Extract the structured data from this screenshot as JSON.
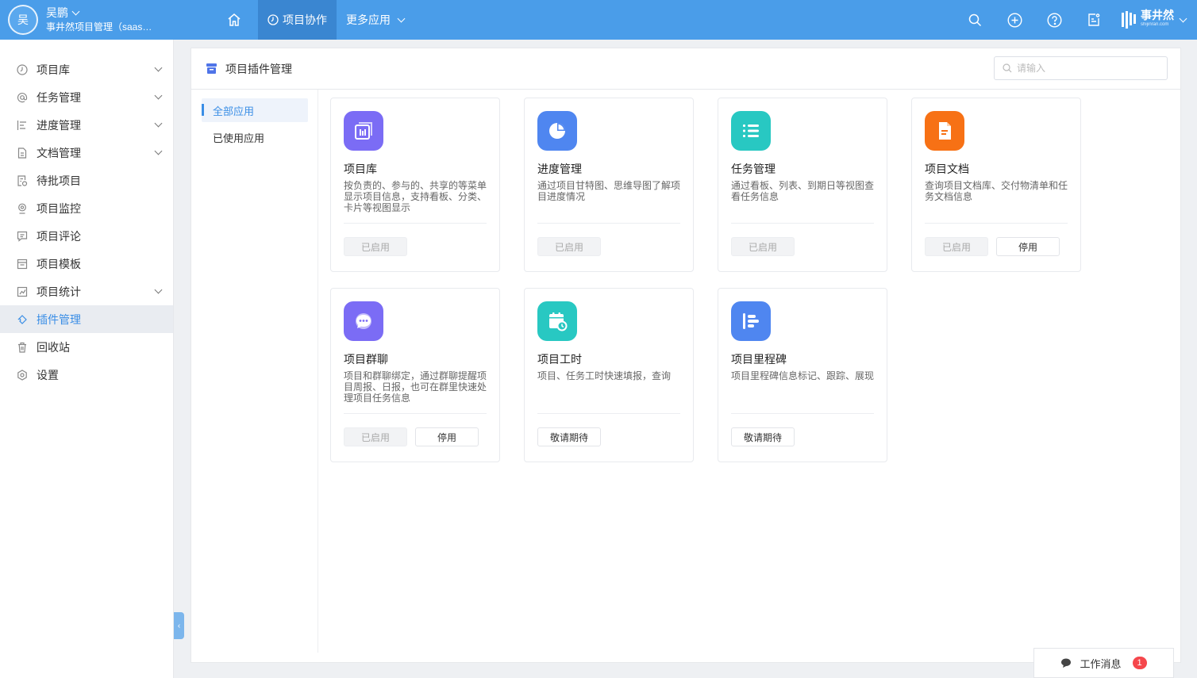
{
  "user": {
    "avatar_char": "吴",
    "name": "吴鹏",
    "org": "事井然项目管理（saas版）"
  },
  "topnav": [
    {
      "label": "项目协作",
      "active": true
    },
    {
      "label": "更多应用",
      "active": false
    }
  ],
  "brand": {
    "name": "事井然",
    "sub": "shijinran.com"
  },
  "sidebar": [
    {
      "label": "项目库",
      "icon": "clock-icon",
      "expandable": true
    },
    {
      "label": "任务管理",
      "icon": "at-icon",
      "expandable": true
    },
    {
      "label": "进度管理",
      "icon": "progress-icon",
      "expandable": true
    },
    {
      "label": "文档管理",
      "icon": "document-icon",
      "expandable": true
    },
    {
      "label": "待批项目",
      "icon": "approval-icon",
      "expandable": false
    },
    {
      "label": "项目监控",
      "icon": "monitor-icon",
      "expandable": false
    },
    {
      "label": "项目评论",
      "icon": "comment-icon",
      "expandable": false
    },
    {
      "label": "项目模板",
      "icon": "template-icon",
      "expandable": false
    },
    {
      "label": "项目统计",
      "icon": "stats-icon",
      "expandable": true
    },
    {
      "label": "插件管理",
      "icon": "plugin-icon",
      "expandable": false,
      "active": true
    },
    {
      "label": "回收站",
      "icon": "trash-icon",
      "expandable": false
    },
    {
      "label": "设置",
      "icon": "settings-icon",
      "expandable": false
    }
  ],
  "panel": {
    "title": "项目插件管理",
    "search_placeholder": "请输入",
    "subnav": [
      {
        "label": "全部应用",
        "active": true
      },
      {
        "label": "已使用应用",
        "active": false
      }
    ]
  },
  "cards": [
    {
      "name": "项目库",
      "desc": "按负责的、参与的、共享的等菜单显示项目信息，支持看板、分类、卡片等视图显示",
      "icon": "project-library-icon",
      "color": "#7b6cf5",
      "buttons": [
        {
          "label": "已启用",
          "disabled": true
        }
      ]
    },
    {
      "name": "进度管理",
      "desc": "通过项目甘特图、思维导图了解项目进度情况",
      "icon": "pie-chart-icon",
      "color": "#4f86f0",
      "buttons": [
        {
          "label": "已启用",
          "disabled": true
        }
      ]
    },
    {
      "name": "任务管理",
      "desc": "通过看板、列表、到期日等视图查看任务信息",
      "icon": "task-list-icon",
      "color": "#28c8c2",
      "buttons": [
        {
          "label": "已启用",
          "disabled": true
        }
      ]
    },
    {
      "name": "项目文档",
      "desc": "查询项目文档库、交付物清单和任务文档信息",
      "icon": "file-icon",
      "color": "#f77115",
      "buttons": [
        {
          "label": "已启用",
          "disabled": true
        },
        {
          "label": "停用",
          "disabled": false
        }
      ]
    },
    {
      "name": "项目群聊",
      "desc": "项目和群聊绑定，通过群聊提醒项目周报、日报，也可在群里快速处理项目任务信息",
      "icon": "chat-icon",
      "color": "#7b6cf5",
      "buttons": [
        {
          "label": "已启用",
          "disabled": true
        },
        {
          "label": "停用",
          "disabled": false
        }
      ]
    },
    {
      "name": "项目工时",
      "desc": "项目、任务工时快速填报，查询",
      "icon": "timesheet-icon",
      "color": "#28c8c2",
      "buttons": [
        {
          "label": "敬请期待",
          "disabled": false
        }
      ]
    },
    {
      "name": "项目里程碑",
      "desc": "项目里程碑信息标记、跟踪、展现",
      "icon": "milestone-icon",
      "color": "#4f86f0",
      "buttons": [
        {
          "label": "敬请期待",
          "disabled": false
        }
      ]
    }
  ],
  "work_message": {
    "label": "工作消息",
    "count": "1"
  }
}
